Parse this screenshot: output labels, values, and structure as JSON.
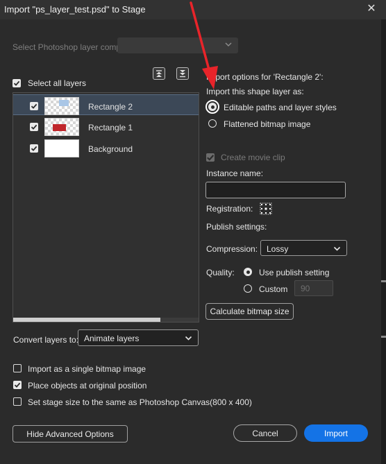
{
  "window": {
    "title": "Import \"ps_layer_test.psd\" to Stage",
    "close_glyph": "✕"
  },
  "layer_comp": {
    "label": "Select Photoshop layer comp:",
    "value": ""
  },
  "select_all": {
    "label": "Select all layers",
    "checked": true
  },
  "layers": [
    {
      "name": "Rectangle 2",
      "checked": true,
      "selected": true
    },
    {
      "name": "Rectangle 1",
      "checked": true,
      "selected": false
    },
    {
      "name": "Background",
      "checked": true,
      "selected": false
    }
  ],
  "convert": {
    "label": "Convert layers to:",
    "value": "Animate layers"
  },
  "bottom_options": [
    {
      "label": "Import as a single bitmap image",
      "checked": false
    },
    {
      "label": "Place objects at original position",
      "checked": true
    },
    {
      "label": "Set stage size to the same as Photoshop Canvas(800 x 400)",
      "checked": false
    }
  ],
  "import_options": {
    "heading": "Import options for 'Rectangle 2':",
    "subheading": "Import this shape layer as:",
    "radio_editable": "Editable paths and layer styles",
    "radio_flattened": "Flattened bitmap image",
    "selected": "editable",
    "create_movie_clip": "Create movie clip",
    "instance_name_label": "Instance name:",
    "instance_name_value": "",
    "registration_label": "Registration:",
    "publish_settings_label": "Publish settings:",
    "compression_label": "Compression:",
    "compression_value": "Lossy",
    "quality_label": "Quality:",
    "quality_use_publish": "Use publish setting",
    "quality_custom": "Custom",
    "quality_custom_value": "90",
    "quality_selected": "use_publish",
    "calc_button": "Calculate bitmap size"
  },
  "buttons": {
    "hide_advanced": "Hide Advanced Options",
    "cancel": "Cancel",
    "import": "Import"
  },
  "colors": {
    "background": "#2b2b2b",
    "primary_button": "#1473e6",
    "annotation_arrow": "#e8242a",
    "rect1_fill": "#c0262b",
    "rect2_fill": "#a9c6e6"
  }
}
